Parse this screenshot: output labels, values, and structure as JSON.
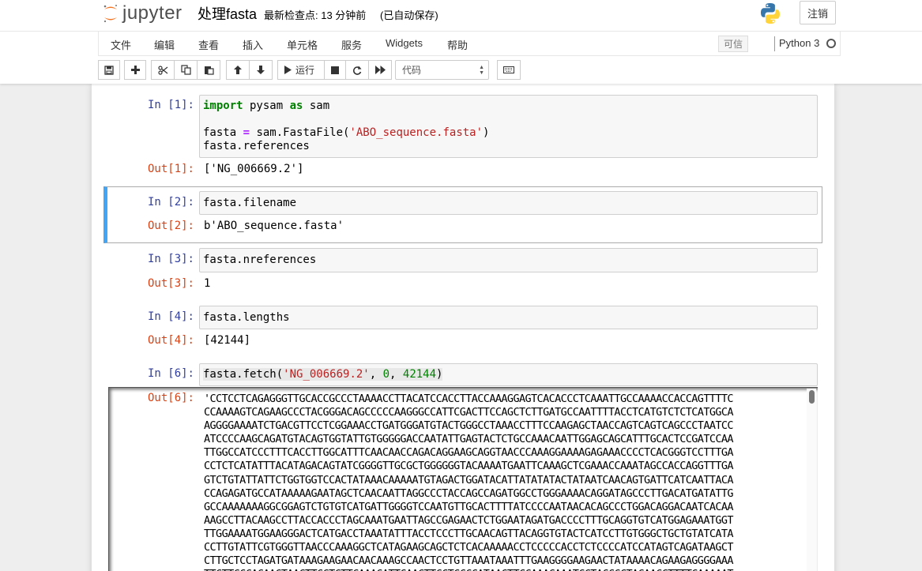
{
  "app": {
    "logo_text": "jupyter",
    "notebook_title": "处理fasta",
    "checkpoint": "最新检查点: 13 分钟前",
    "autosave": "(已自动保存)",
    "logout_label": "注销"
  },
  "menubar": {
    "items": [
      "文件",
      "编辑",
      "查看",
      "插入",
      "单元格",
      "服务",
      "Widgets",
      "帮助"
    ],
    "trusted_label": "可信",
    "kernel_name": "Python 3"
  },
  "toolbar": {
    "run_label": "运行",
    "cell_type": "代码",
    "buttons": [
      "save-icon",
      "plus-icon",
      "cut-icon",
      "copy-icon",
      "paste-icon",
      "arrow-up-icon",
      "arrow-down-icon",
      "play-icon",
      "stop-icon",
      "restart-icon",
      "fast-forward-icon",
      "keyboard-icon"
    ]
  },
  "cells": [
    {
      "in_prompt": "In [1]:",
      "out_prompt": "Out[1]:",
      "output": "['NG_006669.2']"
    },
    {
      "in_prompt": "In [2]:",
      "code": "fasta.filename",
      "out_prompt": "Out[2]:",
      "output": "b'ABO_sequence.fasta'"
    },
    {
      "in_prompt": "In [3]:",
      "code": "fasta.nreferences",
      "out_prompt": "Out[3]:",
      "output": "1"
    },
    {
      "in_prompt": "In [4]:",
      "code": "fasta.lengths",
      "out_prompt": "Out[4]:",
      "output": "[42144]"
    },
    {
      "in_prompt": "In [6]:",
      "out_prompt": "Out[6]:",
      "sequence_lines": [
        "'CCTCCTCAGAGGGTTGCACCGCCCTAAAACCTTACATCCACCTTACCAAAGGAGTCACACCCTCAAATTGCCAAAACCACCAGTTTTC",
        "CCAAAAGTCAGAAGCCCTACGGGACAGCCCCCAAGGGCCATTCGACTTCCAGCTCTTGATGCCAATTTTACCTCATGTCTCTCATGGCA",
        "AGGGGAAAATCTGACGTTCCTCGGAAACCTGATGGGATGTACTGGGCCTAAACCTTTCCAAGAGCTAACCAGTCAGTCAGCCCTAATCC",
        "ATCCCCAAGCAGATGTACAGTGGTATTGTGGGGGACCAATATTGAGTACTCTGCCAAACAATTGGAGCAGCATTTGCACTCCGATCCAA",
        "TTGGCCATCCCTTTCACCTTGGCATTTCAACAACCAGACAGGAAGCAGGTAACCCAAAGGAAAAGAGAAACCCCTCACGGGTCCTTTGA",
        "CCTCTCATATTTACATAGACAGTATCGGGGTTGCGCTGGGGGGTACAAAATGAATTCAAAGCTCGAAACCAAATAGCCACCAGGTTTGA",
        "GTCTGTATTATTCTGGTGGTCCACTATAAACAAAAATGTAGACTGGATACATTATATATACTATAATCAACAGTGATTCATCAATTACA",
        "CCAGAGATGCCATAAAAAGAATAGCTCAACAATTAGGCCCTACCAGCCAGATGGCCTGGGAAAACAGGATAGCCCTTGACATGATATTG",
        "GCCAAAAAAAGGCGGAGTCTGTGTCATGATTGGGGTCCAATGTTGCACTTTTATCCCCAATAACACAGCCCTGGACAGGACAATCACAA",
        "AAGCCTTACAAGCCTTACCACCCTAGCAAATGAATTAGCCGAGAACTCTGGAATAGATGACCCCTTTGCAGGTGTCATGGAGAAATGGT",
        "TTGGAAAATGGAAGGGACTCATGACCTAAATATTTACCTCCCTTGCAACAGTTACAGGTGTACTCATCCTTGTGGGCTGCTGTATCATA",
        "CCTTGTATTCGTGGGTTAACCCAAAGGCTCATAGAAGCAGCTCTCACAAAAACCTCCCCCACCTCTCCCCATCCATAGTCAGATAAGCT",
        "CTTGCTCCTAGATGATAAAGAAGAACAACAAAGCCAACTCCTGTTAAATAAATTTGAAGGGGAAGAACTATAAAACAGAAGAGGGGAAA",
        "TTCTTCCCACAACTAACTTCCTCTTCAAACATTCAACTTCCTCCCCATAACTTCCAAACAAATCCTACCCCTACAACCTTTTCAAAAAT"
      ]
    }
  ]
}
